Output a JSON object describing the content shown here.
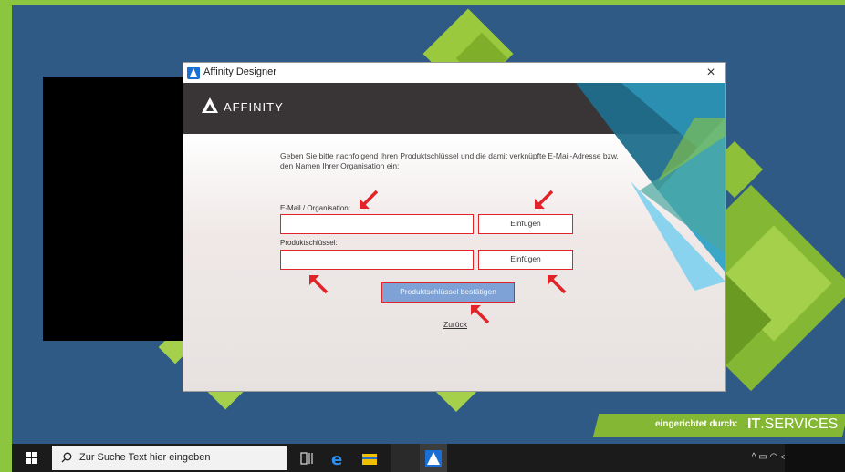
{
  "window": {
    "title": "Affinity Designer",
    "close_glyph": "×",
    "logo_text": "AFFINITY"
  },
  "dialog": {
    "intro_line1": "Geben Sie bitte nachfolgend Ihren Produktschlüssel und die damit verknüpfte E-Mail-Adresse bzw.",
    "intro_line2": "den Namen Ihrer Organisation ein:",
    "email_label": "E-Mail / Organisation:",
    "email_value": "",
    "email_paste_label": "Einfügen",
    "key_label": "Produktschlüssel:",
    "key_value": "",
    "key_paste_label": "Einfügen",
    "confirm_label": "Produktschlüssel bestätigen",
    "back_label": "Zurück"
  },
  "branding": {
    "prefix": "eingerichtet durch:",
    "it": "IT",
    "services": ".SERVICES"
  },
  "taskbar": {
    "search_placeholder": "Zur Suche Text hier eingeben",
    "tray_icons": "^ ▭ ◠ ◁)"
  },
  "colors": {
    "accent_green": "#8cc63f",
    "desktop_blue": "#2f5a86",
    "annotation_red": "#e0242a",
    "confirm_blue": "#7ea2d6",
    "banner_dark": "#393536"
  }
}
